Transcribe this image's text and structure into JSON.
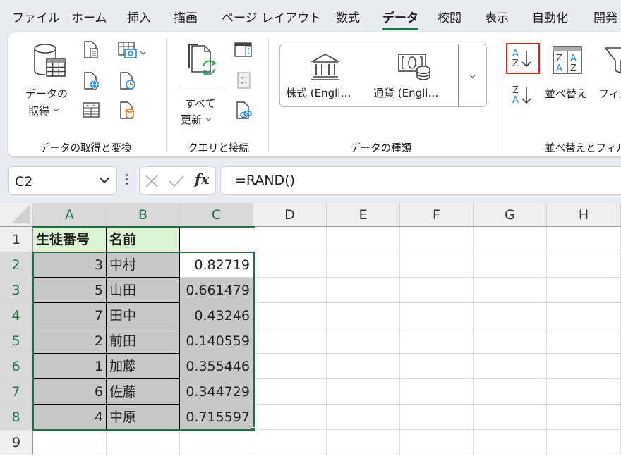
{
  "menu": {
    "tabs": [
      {
        "label": "ファイル"
      },
      {
        "label": "ホーム"
      },
      {
        "label": "挿入"
      },
      {
        "label": "描画"
      },
      {
        "label": "ページ レイアウト"
      },
      {
        "label": "数式"
      },
      {
        "label": "データ",
        "active": true
      },
      {
        "label": "校閲"
      },
      {
        "label": "表示"
      },
      {
        "label": "自動化"
      },
      {
        "label": "開発"
      }
    ]
  },
  "ribbon": {
    "groups": {
      "get_transform": {
        "label": "データの取得と変換",
        "get_data_line1": "データの",
        "get_data_line2": "取得",
        "small_icons": [
          "from-text-csv-icon",
          "from-picture-icon",
          "from-web-icon",
          "recent-sources-icon",
          "from-table-range-icon",
          "existing-connections-icon"
        ]
      },
      "queries": {
        "label": "クエリと接続",
        "refresh_line1": "すべて",
        "refresh_line2": "更新",
        "small_icons": [
          "queries-connections-icon",
          "properties-icon",
          "edit-links-icon"
        ]
      },
      "data_types": {
        "label": "データの種類",
        "stocks": "株式 (Engli…",
        "currencies": "通貨 (Engli…"
      },
      "sort_filter": {
        "label": "並べ替えとフィル",
        "sort_label": "並べ替え",
        "filter_label": "フィル",
        "sort_asc_letters": [
          "A",
          "Z"
        ],
        "sort_desc_letters": [
          "Z",
          "A"
        ]
      }
    }
  },
  "formula_bar": {
    "name_box": "C2",
    "formula": "=RAND()",
    "fx": "fx"
  },
  "sheet": {
    "columns": [
      "A",
      "B",
      "C",
      "D",
      "E",
      "F",
      "G",
      "H"
    ],
    "rows": [
      "1",
      "2",
      "3",
      "4",
      "5",
      "6",
      "7",
      "8",
      "9"
    ],
    "header": [
      "生徒番号",
      "名前",
      ""
    ],
    "data": [
      {
        "id": "3",
        "name": "中村",
        "rand": "0.82719"
      },
      {
        "id": "5",
        "name": "山田",
        "rand": "0.661479"
      },
      {
        "id": "7",
        "name": "田中",
        "rand": "0.43246"
      },
      {
        "id": "2",
        "name": "前田",
        "rand": "0.140559"
      },
      {
        "id": "1",
        "name": "加藤",
        "rand": "0.355446"
      },
      {
        "id": "6",
        "name": "佐藤",
        "rand": "0.344729"
      },
      {
        "id": "4",
        "name": "中原",
        "rand": "0.715597"
      }
    ],
    "active_cell": "C2",
    "selection": "A2:C8",
    "colors": {
      "accent": "#1e7145",
      "header_fill": "#dbf2d3",
      "range_fill": "#c8c8c8",
      "highlight_box": "#e0201c",
      "icon_blue": "#1f8ad2",
      "icon_green": "#2fa84f",
      "icon_orange": "#e07b1a"
    }
  }
}
